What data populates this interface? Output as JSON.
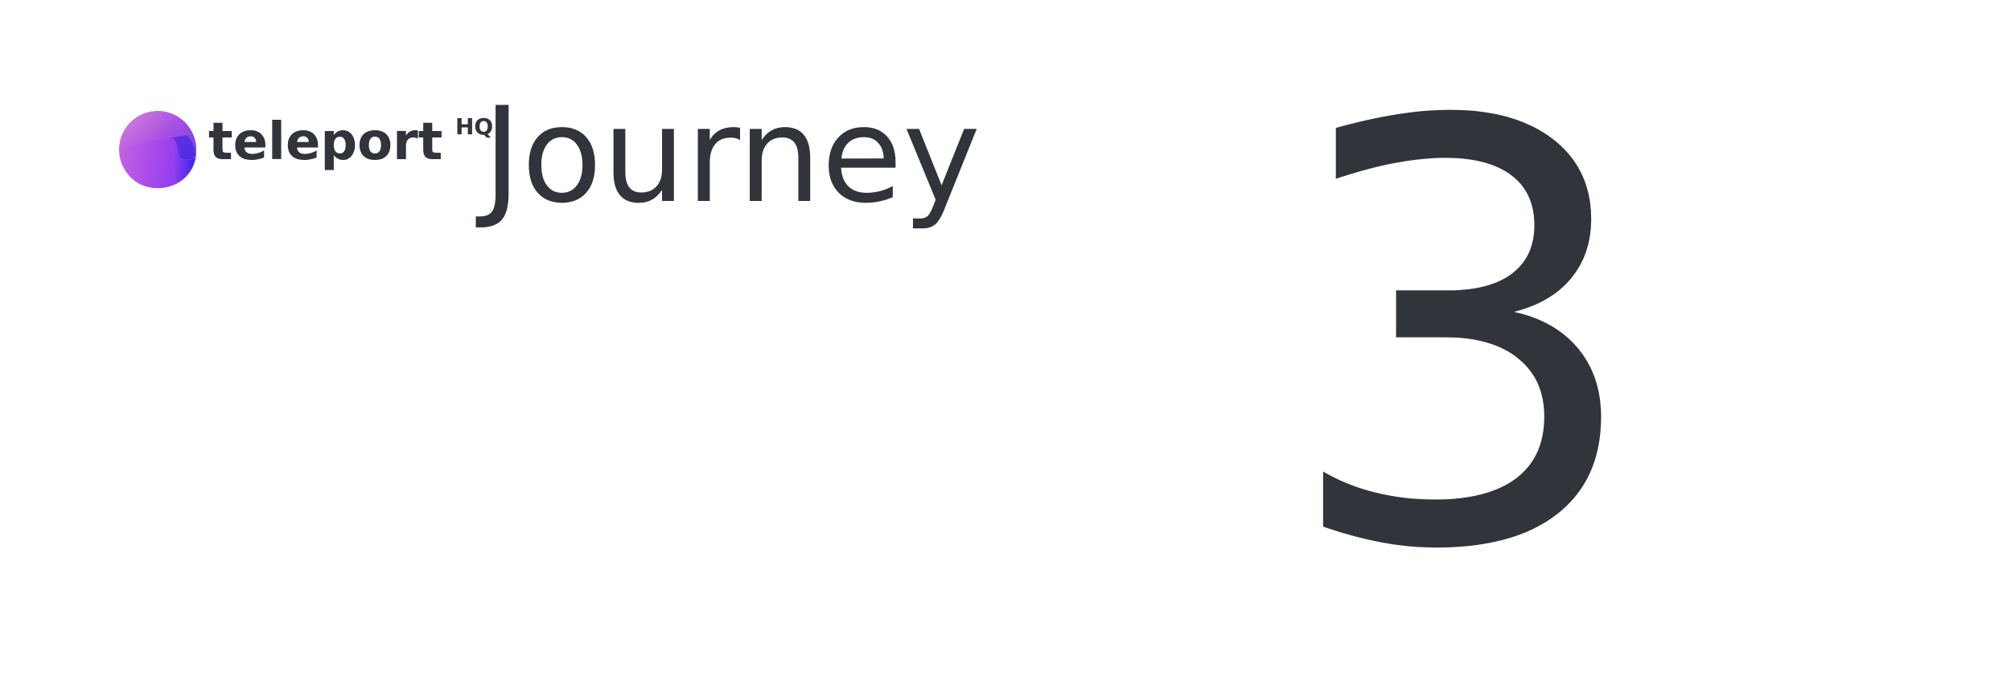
{
  "brand": {
    "name": "teleport",
    "superscript": "HQ",
    "logo_icon": "teleporthq-logo-icon",
    "colors": {
      "logo_light": "#c86ee0",
      "logo_mid": "#9b3fe0",
      "logo_dark": "#2a1ee6"
    }
  },
  "title": "Journey",
  "number": "3",
  "colors": {
    "text": "#31343b",
    "background": "#ffffff"
  }
}
